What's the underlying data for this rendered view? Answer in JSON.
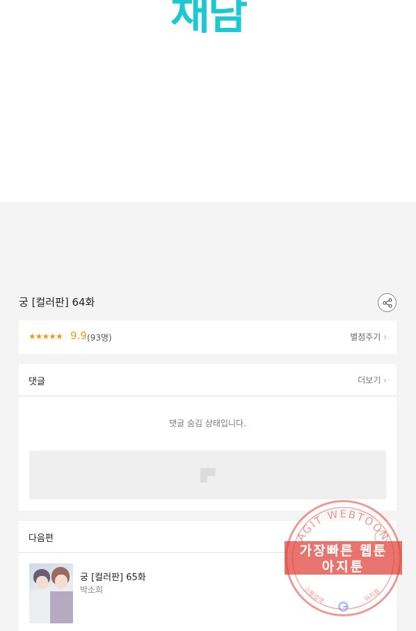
{
  "banner": {
    "text": "채담"
  },
  "episode": {
    "title": "궁 [컬러판] 64화"
  },
  "rating": {
    "stars_display": "★★★★★",
    "score": "9.9",
    "votes": "(93명)",
    "rate_link": "별점주기",
    "accent_color": "#f19b1a"
  },
  "comments": {
    "header": "댓글",
    "more": "더보기",
    "hidden_notice": "댓글 숨김 상태입니다."
  },
  "next_episode": {
    "header": "다음편",
    "title": "궁 [컬러판] 65화",
    "author": "박소희"
  },
  "watermark": {
    "arc_text": "AGIT WEBTOON",
    "line1": "가장빠른 웹툰",
    "line2": "아지툰",
    "small_left": "고퀄검색",
    "small_right": "아지툰",
    "color": "#e0463c"
  },
  "icons": {
    "share": "share-icon",
    "chevron": "chevron-right-icon",
    "ad": "ad-placeholder-icon"
  },
  "colors": {
    "brand_teal": "#1ec8d2",
    "background": "#f4f4f4"
  }
}
